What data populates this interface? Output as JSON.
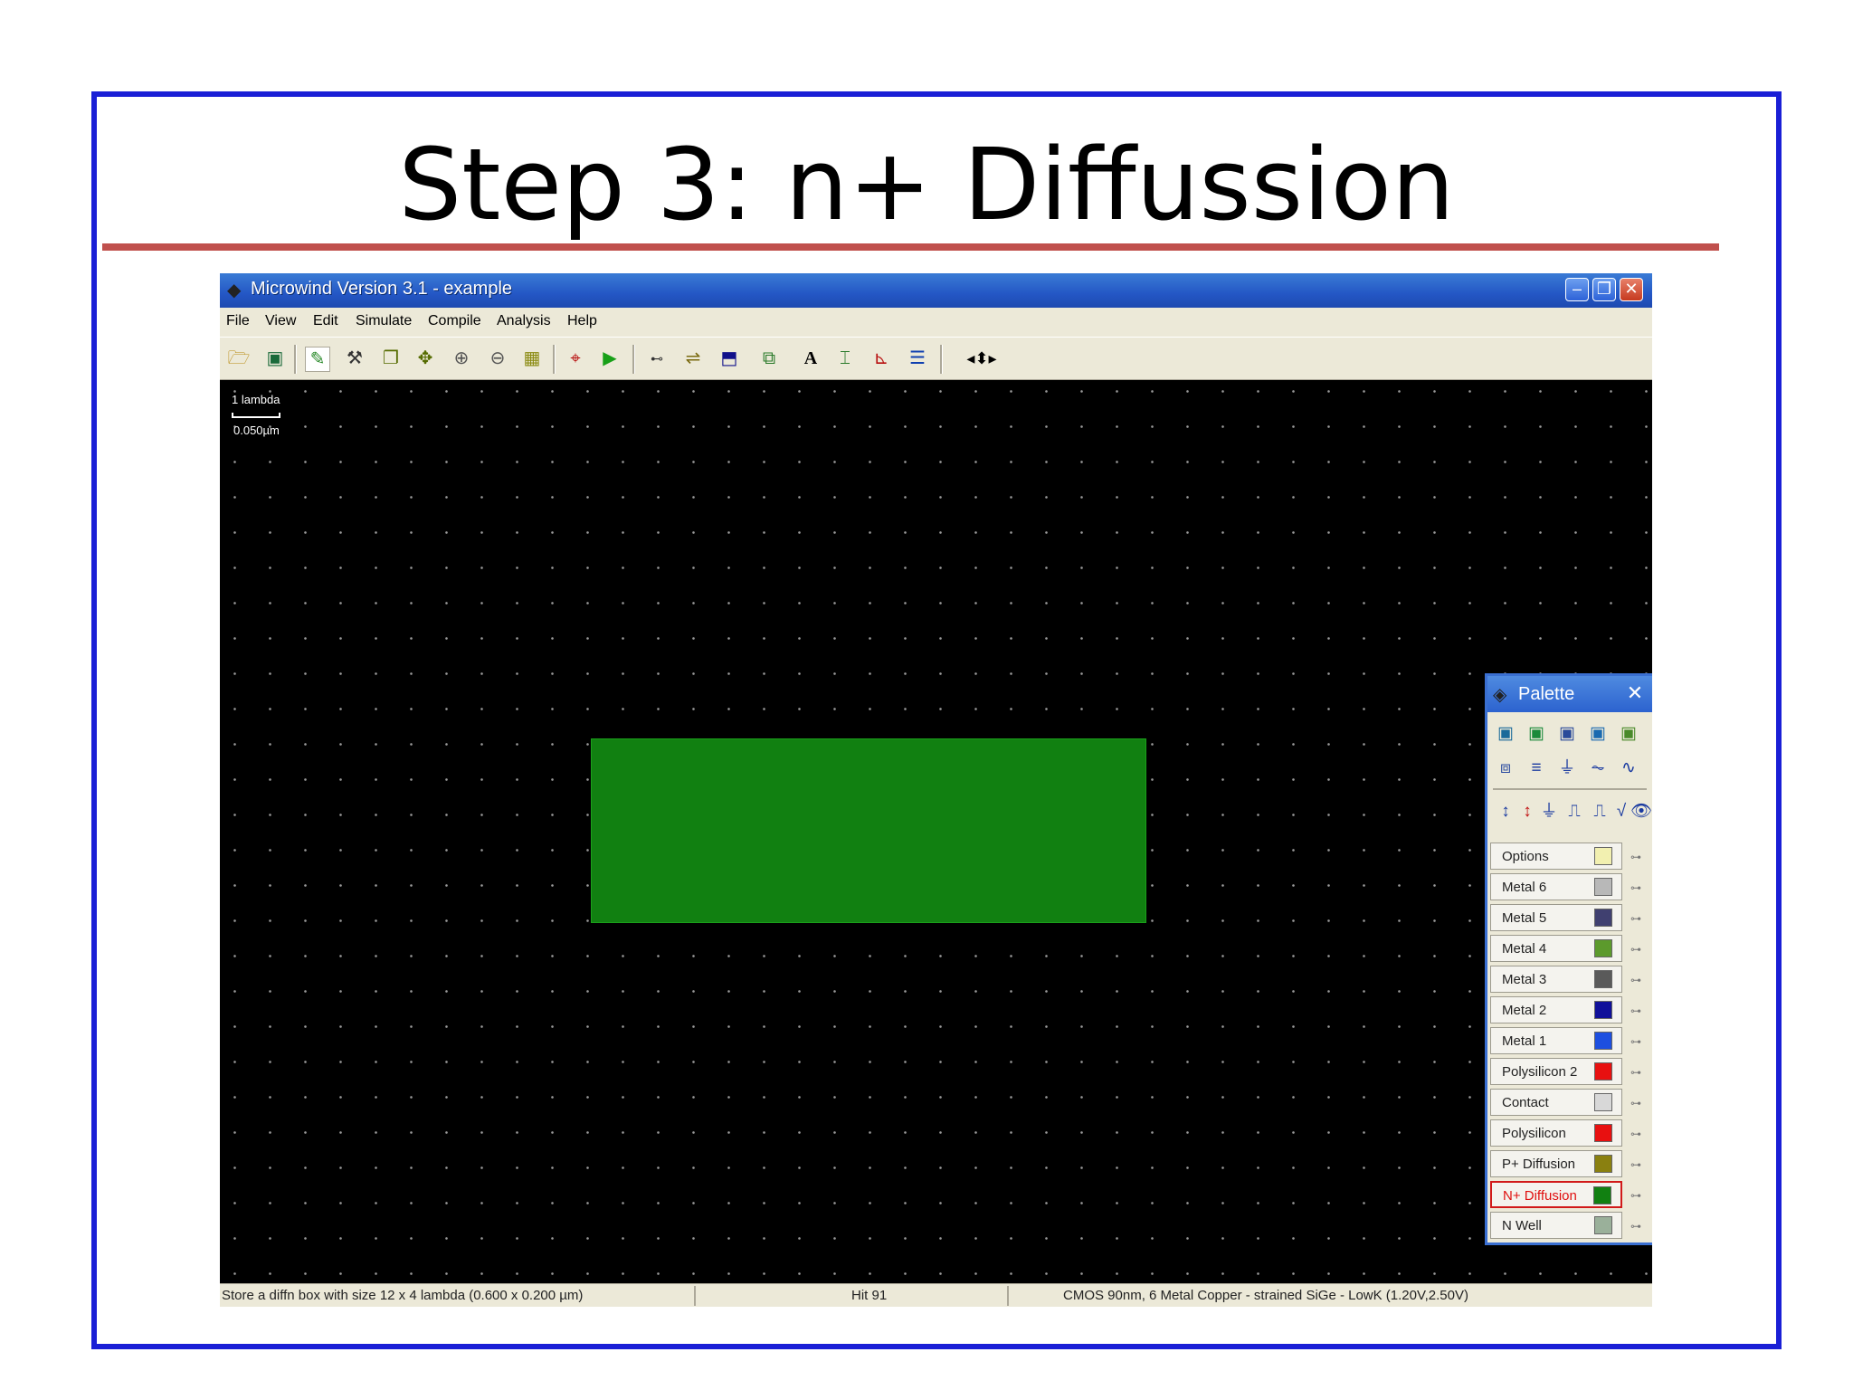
{
  "slide": {
    "title": "Step 3: n+ Diffussion"
  },
  "window": {
    "title": "Microwind Version 3.1 - example",
    "buttons": [
      "minimize",
      "restore",
      "close"
    ]
  },
  "menu": [
    "File",
    "View",
    "Edit",
    "Simulate",
    "Compile",
    "Analysis",
    "Help"
  ],
  "toolbar": {
    "icons": [
      "open-icon",
      "save-icon",
      "draw-box-icon",
      "connect-icon",
      "copy-icon",
      "move-icon",
      "zoom-in-icon",
      "zoom-out-icon",
      "view-all-icon",
      "cross-section-icon",
      "run-simulation-icon",
      "measure-icon",
      "stretch-icon",
      "3d-view-icon",
      "pads-icon",
      "text-icon",
      "protect-icon",
      "waveform-icon",
      "layers-icon",
      "scroll-arrows-icon"
    ]
  },
  "canvas": {
    "scale_label": "1 lambda",
    "scale_value": "0.050µm",
    "box_layer": "N+ Diffusion",
    "box_color": "#118011"
  },
  "palette": {
    "title": "Palette",
    "layers": [
      {
        "label": "Options",
        "color": "#f2f0b0"
      },
      {
        "label": "Metal 6",
        "color": "#b8b8b8"
      },
      {
        "label": "Metal 5",
        "color": "#404070"
      },
      {
        "label": "Metal 4",
        "color": "#5c9a2c"
      },
      {
        "label": "Metal 3",
        "color": "#5a5a5a"
      },
      {
        "label": "Metal 2",
        "color": "#10109a"
      },
      {
        "label": "Metal 1",
        "color": "#1d4fe0"
      },
      {
        "label": "Polysilicon 2",
        "color": "#e81010"
      },
      {
        "label": "Contact",
        "color": "#d8d8d8"
      },
      {
        "label": "Polysilicon",
        "color": "#e81010"
      },
      {
        "label": "P+ Diffusion",
        "color": "#8a8010"
      },
      {
        "label": "N+ Diffusion",
        "color": "#118011"
      },
      {
        "label": "N Well",
        "color": "#9ab09a"
      }
    ],
    "selected": "N+ Diffusion"
  },
  "status": {
    "message": "Store a diffn box with size 12 x 4 lambda (0.600 x 0.200 µm)",
    "hit": "Hit 91",
    "technology": "CMOS 90nm, 6 Metal Copper - strained SiGe - LowK (1.20V,2.50V)"
  }
}
